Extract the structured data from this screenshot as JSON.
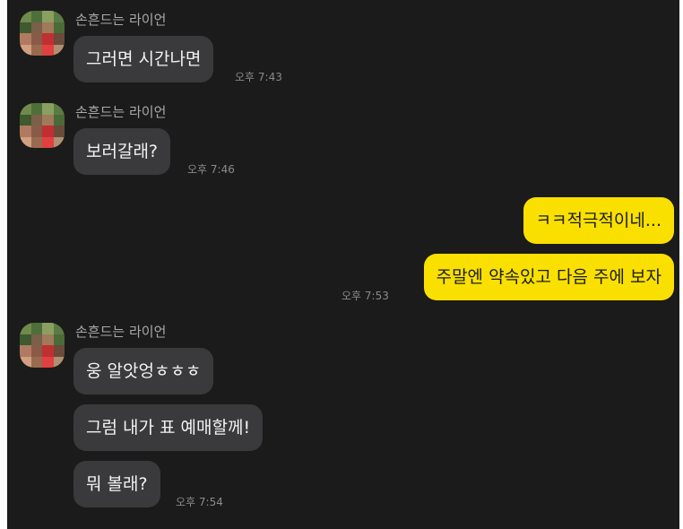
{
  "colors": {
    "background": "#1b1b1b",
    "incoming_bubble": "#3a3a3c",
    "outgoing_bubble": "#f9e000",
    "timestamp": "#8a8a8a",
    "sender_name": "#a9a9a9"
  },
  "chat": {
    "groups": [
      {
        "sender": "손흔드는 라이언",
        "messages": [
          "그러면 시간나면"
        ],
        "time": "오후 7:43"
      },
      {
        "sender": "손흔드는 라이언",
        "messages": [
          "보러갈래?"
        ],
        "time": "오후 7:46"
      },
      {
        "sender": "me",
        "messages": [
          "ㅋㅋ적극적이네...",
          "주말엔 약속있고 다음 주에 보자"
        ],
        "time": "오후 7:53"
      },
      {
        "sender": "손흔드는 라이언",
        "messages": [
          "웅 알앗엉ㅎㅎㅎ",
          "그럼 내가 표 예매할께!",
          "뭐 볼래?"
        ],
        "time": "오후 7:54"
      }
    ]
  }
}
